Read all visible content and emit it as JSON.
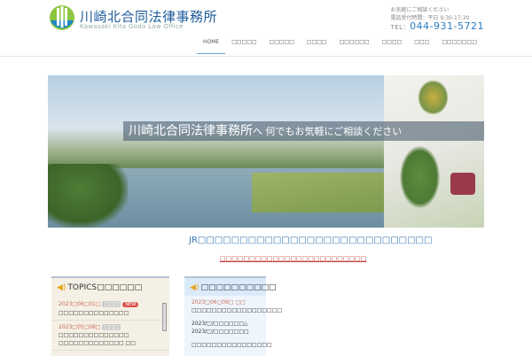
{
  "header": {
    "title": "川崎北合同法律事務所",
    "subtitle": "Kawasaki Kita Godo Law Office",
    "contact_line": "お気軽にご相談ください",
    "hours": "電話受付時間：平日 9:30-17:30",
    "tel_label": "TEL：",
    "tel": "044-931-5721"
  },
  "nav": [
    "HOME",
    "□□□□□",
    "□□□□□",
    "□□□□",
    "□□□□□□",
    "□□□□",
    "□□□",
    "□□□□□□□"
  ],
  "banner": {
    "slogan": "川崎北合同法律事務所",
    "slogan_tail": "へ 何でもお気軽にご相談ください"
  },
  "lead": "JR□□□□□□□□□□□□□□□□□□□□□□□□□□□□",
  "red_link": "□□□□□□□□□□□□□□□□□□□□□□□□□",
  "topics": {
    "title": "TOPICS□□□□□□",
    "items": [
      {
        "date": "2023□06□01□",
        "tag": "□□□",
        "new": "NEW",
        "text": "□□□□□□□□□□□□□□"
      },
      {
        "date": "2023□05□08□",
        "tag": "□□□",
        "text": "□□□□□□□□□□□□□□ □□□□□□□□□□□□□ □□"
      }
    ]
  },
  "notice": {
    "title": "□□□□□□□□□□",
    "items": [
      {
        "date": "2023□06□09□ □□",
        "text": "□□□□□□□□□□□□□□□□□□"
      },
      {
        "text": "2023/□/□□□□□□△ 2023/□/□□□□□□□"
      },
      {
        "text": "□□□□□□□□□□□□□□□□"
      }
    ]
  }
}
